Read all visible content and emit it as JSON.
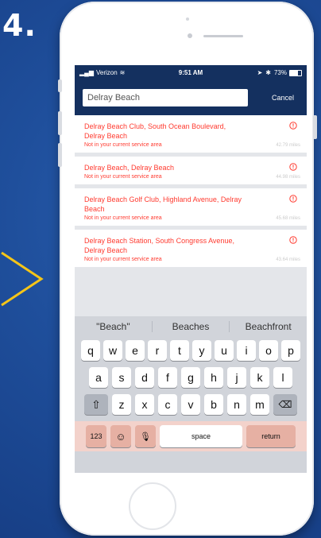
{
  "step_label": "4.",
  "status_bar": {
    "carrier": "Verizon",
    "time": "9:51 AM",
    "battery": "73%"
  },
  "search": {
    "value": "Delray Beach",
    "cancel_label": "Cancel"
  },
  "results": [
    {
      "name": "Delray Beach Club, South Ocean Boulevard, Delray Beach",
      "note": "Not in your current service area",
      "distance": "42.79 miles"
    },
    {
      "name": "Delray Beach, Delray Beach",
      "note": "Not in your current service area",
      "distance": "44.98 miles"
    },
    {
      "name": "Delray Beach Golf Club, Highland Avenue, Delray Beach",
      "note": "Not in your current service area",
      "distance": "45.68 miles"
    },
    {
      "name": "Delray Beach Station, South Congress Avenue, Delray Beach",
      "note": "Not in your current service area",
      "distance": "43.64 miles"
    }
  ],
  "keyboard": {
    "suggestions": [
      "\"Beach\"",
      "Beaches",
      "Beachfront"
    ],
    "row1": [
      "q",
      "w",
      "e",
      "r",
      "t",
      "y",
      "u",
      "i",
      "o",
      "p"
    ],
    "row2": [
      "a",
      "s",
      "d",
      "f",
      "g",
      "h",
      "j",
      "k",
      "l"
    ],
    "row3": [
      "z",
      "x",
      "c",
      "v",
      "b",
      "n",
      "m"
    ],
    "numbers_label": "123",
    "space_label": "space",
    "return_label": "return"
  },
  "colors": {
    "accent_red": "#ff3b30",
    "navy": "#14305f"
  }
}
